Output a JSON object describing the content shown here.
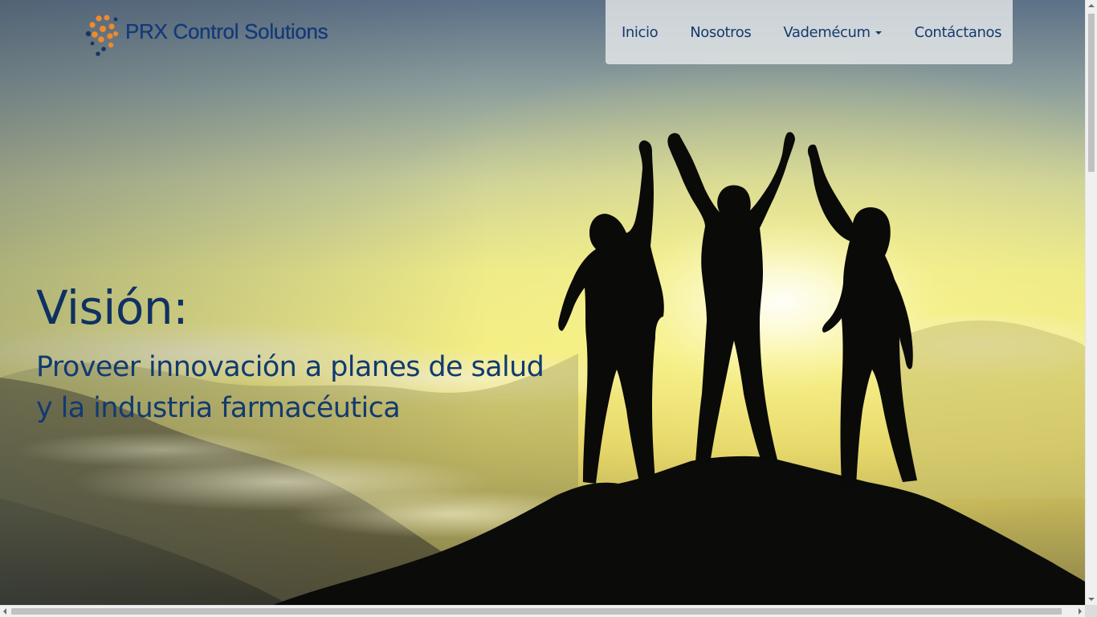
{
  "brand": {
    "name": "PRX Control Solutions",
    "logo_icon": "orange-dots-logo-icon"
  },
  "nav": {
    "items": [
      {
        "label": "Inicio"
      },
      {
        "label": "Nosotros"
      },
      {
        "label": "Vademécum",
        "dropdown": true,
        "icon": "caret-down-icon"
      },
      {
        "label": "Contáctanos"
      }
    ]
  },
  "hero": {
    "title": "Visión:",
    "text_line1": "Proveer innovación a planes de salud",
    "text_line2": "y la industria farmacéutica",
    "background_image": "three-people-silhouette-summit-sunrise"
  },
  "colors": {
    "brand_blue": "#143a78",
    "logo_orange": "#f08a2c",
    "logo_navy": "#1a3563",
    "nav_background": "#eceeee",
    "sky_top": "#5e7286",
    "sun_yellow": "#f6f07a"
  }
}
